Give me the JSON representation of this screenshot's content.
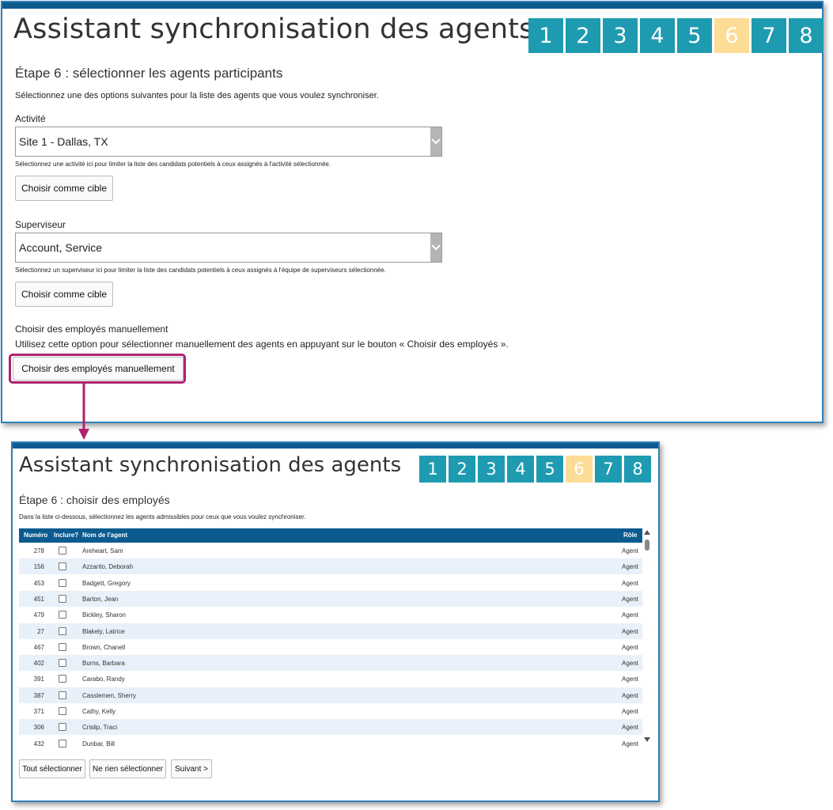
{
  "top": {
    "title": "Assistant synchronisation des agents",
    "steps": [
      "1",
      "2",
      "3",
      "4",
      "5",
      "6",
      "7",
      "8"
    ],
    "active_step": "6",
    "subtitle": "Étape 6 : sélectionner les agents participants",
    "instructions": "Sélectionnez une des options suivantes pour la liste des agents que vous voulez synchroniser.",
    "activity_label": "Activité",
    "activity_value": "Site 1 - Dallas, TX",
    "activity_help": "Sélectionnez une activité ici pour limiter la liste des candidats potentiels à ceux assignés à l'activité sélectionnée.",
    "target_button_1": "Choisir comme cible",
    "supervisor_label": "Superviseur",
    "supervisor_value": "Account, Service",
    "supervisor_help": "Sélectionnez un superviseur ici pour limiter la liste des candidats potentiels à ceux assignés à l'équipe de superviseurs sélectionnée.",
    "target_button_2": "Choisir comme cible",
    "manual_label": "Choisir des employés manuellement",
    "manual_help": "Utilisez cette option pour sélectionner manuellement des agents en appuyant sur le bouton « Choisir des employés ».",
    "manual_button": "Choisir des employés manuellement"
  },
  "bottom": {
    "title": "Assistant synchronisation des agents",
    "subtitle": "Étape 6 : choisir des employés",
    "instructions": "Dans la liste ci-dessous, sélectionnez les agents admissibles pour ceux que vous voulez synchroniser.",
    "columns": {
      "num": "Numéro",
      "include": "Inclure?",
      "name": "Nom de l'agent",
      "role": "Rôle"
    },
    "rows": [
      {
        "num": "278",
        "name": "Areheart, Sam",
        "role": "Agent"
      },
      {
        "num": "156",
        "name": "Azzarito, Deborah",
        "role": "Agent"
      },
      {
        "num": "453",
        "name": "Badgett, Gregory",
        "role": "Agent"
      },
      {
        "num": "451",
        "name": "Barton, Jean",
        "role": "Agent"
      },
      {
        "num": "479",
        "name": "Bickley, Sharon",
        "role": "Agent"
      },
      {
        "num": "27",
        "name": "Blakely, Latrice",
        "role": "Agent"
      },
      {
        "num": "467",
        "name": "Brown, Chanell",
        "role": "Agent"
      },
      {
        "num": "402",
        "name": "Burns, Barbara",
        "role": "Agent"
      },
      {
        "num": "391",
        "name": "Carabo, Randy",
        "role": "Agent"
      },
      {
        "num": "387",
        "name": "Casslemen, Sherry",
        "role": "Agent"
      },
      {
        "num": "371",
        "name": "Cathy, Kelly",
        "role": "Agent"
      },
      {
        "num": "306",
        "name": "Crislip, Traci",
        "role": "Agent"
      },
      {
        "num": "432",
        "name": "Dunbar, Bill",
        "role": "Agent"
      }
    ],
    "select_all": "Tout sélectionner",
    "select_none": "Ne rien sélectionner",
    "next": "Suivant >"
  },
  "colors": {
    "brand": "#0b5b8f",
    "step": "#1e9bb0",
    "step_active": "#fddc96",
    "highlight": "#b0226e"
  },
  "icons": [
    "chevron-down-icon",
    "scroll-up-icon",
    "scroll-down-icon",
    "connector-arrow-icon"
  ]
}
